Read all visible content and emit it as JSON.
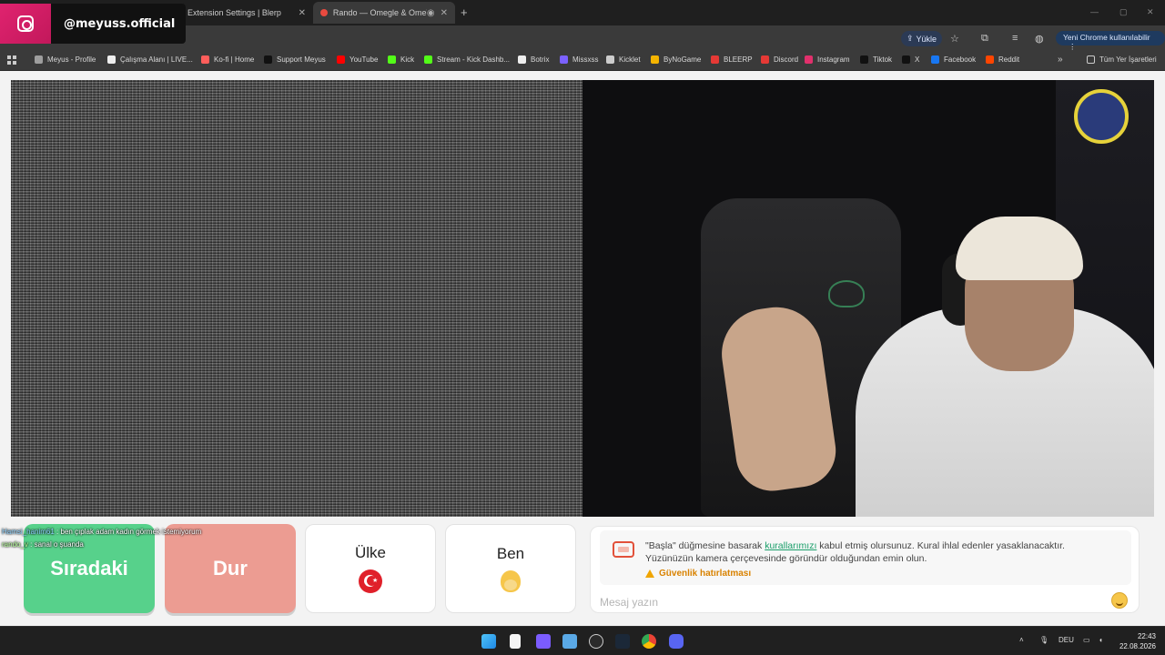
{
  "tabs": [
    {
      "label": "Extension Settings | Blerp",
      "active": false
    },
    {
      "label": "Rando — Omegle & OmeTV",
      "active": true
    }
  ],
  "overlay": {
    "instagram_handle": "@meyuss.official"
  },
  "toolbar": {
    "upload_label": "Yükle",
    "chrome_pill": "Yeni Chrome kullanılabilir"
  },
  "bookmarks": [
    {
      "label": "Meyus - Profile",
      "color": "#9e9e9e"
    },
    {
      "label": "Çalışma Alanı | LIVE...",
      "color": "#eeeeee"
    },
    {
      "label": "Ko-fi | Home",
      "color": "#ff5e5b"
    },
    {
      "label": "Support Meyus",
      "color": "#111111"
    },
    {
      "label": "YouTube",
      "color": "#ff0000"
    },
    {
      "label": "Kick",
      "color": "#53fc18"
    },
    {
      "label": "Stream - Kick Dashb...",
      "color": "#53fc18"
    },
    {
      "label": "Botrix",
      "color": "#eeeeee"
    },
    {
      "label": "Missxss",
      "color": "#7b61ff"
    },
    {
      "label": "Kicklet",
      "color": "#cccccc"
    },
    {
      "label": "ByNoGame",
      "color": "#f4b400"
    },
    {
      "label": "BLEERP",
      "color": "#e53935"
    },
    {
      "label": "Discord",
      "color": "#e53935"
    },
    {
      "label": "Instagram",
      "color": "#e1306c"
    },
    {
      "label": "Tiktok",
      "color": "#111111"
    },
    {
      "label": "X",
      "color": "#111111"
    },
    {
      "label": "Facebook",
      "color": "#1877f2"
    },
    {
      "label": "Reddit",
      "color": "#ff4500"
    }
  ],
  "bookmarks_folder": "Tüm Yer İşaretleri",
  "controls": {
    "next_label": "Sıradaki",
    "stop_label": "Dur",
    "country_label": "Ülke",
    "me_label": "Ben"
  },
  "chat_overlay": [
    {
      "user": "Hamsi_hanim61",
      "message": ": ben çıplak adam kadın görmek istemiyorum"
    },
    {
      "user": "rando_v",
      "message": ": sanal o şuanda"
    }
  ],
  "info": {
    "text_before_link": "\"Başla\" düğmesine basarak ",
    "link_text": "kurallarımızı",
    "text_after_link": " kabul etmiş olursunuz. Kural ihlal edenler yasaklanacaktır.",
    "line2": "Yüzünüzün kamera çerçevesinde göründür olduğundan emin olun.",
    "safety_label": "Güvenlik hatırlatması"
  },
  "message_input": {
    "placeholder": "Mesaj yazın",
    "value": ""
  },
  "taskbar": {
    "lang": "DEU",
    "time": "22:43",
    "date": "22.08.2026"
  }
}
